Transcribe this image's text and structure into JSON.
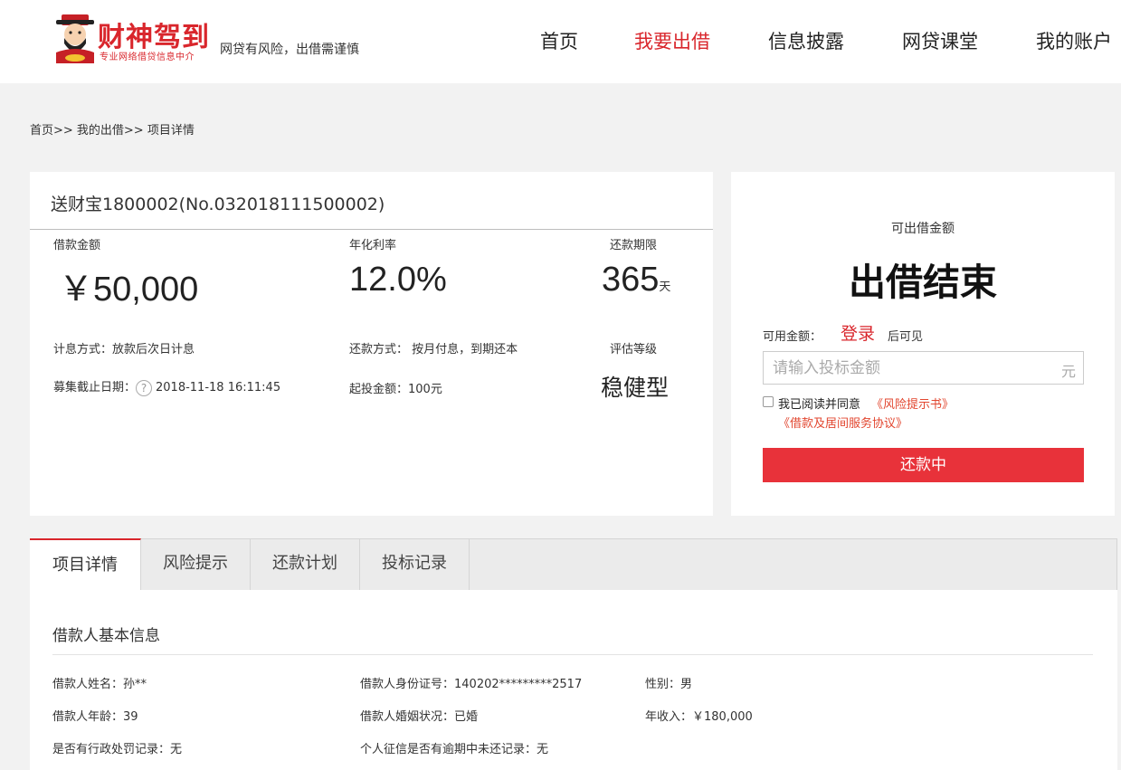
{
  "header": {
    "logo_text": "财神驾到",
    "logo_sub": "专业网络借贷信息中介",
    "slogan": "网贷有风险，出借需谨慎",
    "nav": [
      "首页",
      "我要出借",
      "信息披露",
      "网贷课堂",
      "我的账户"
    ],
    "active_nav": "我要出借"
  },
  "breadcrumb": "首页>> 我的出借>> 项目详情",
  "project": {
    "title": "送财宝1800002(No.032018111500002)",
    "amount_label": "借款金额",
    "amount_value": "￥50,000",
    "rate_label": "年化利率",
    "rate_value": "12.0%",
    "term_label": "还款期限",
    "term_value": "365",
    "term_unit": "天",
    "interest_method": "计息方式：放款后次日计息",
    "repay_method": "还款方式： 按月付息，到期还本",
    "rating_label": "评估等级",
    "deadline_label": "募集截止日期：",
    "deadline_value": "2018-11-18 16:11:45",
    "min_invest": "起投金额：100元",
    "rating_value": "稳健型"
  },
  "invest_panel": {
    "available_label": "可出借金额",
    "status": "出借结束",
    "balance_label": "可用金额：",
    "login_link": "登录",
    "after_login": "后可见",
    "input_placeholder": "请输入投标金额",
    "input_unit": "元",
    "agree_text": "我已阅读并同意",
    "agree_link1": "《风险提示书》",
    "agree_link2": "《借款及居间服务协议》",
    "button_label": "还款中"
  },
  "tabs": [
    "项目详情",
    "风险提示",
    "还款计划",
    "投标记录"
  ],
  "active_tab": "项目详情",
  "borrower": {
    "section_title": "借款人基本信息",
    "name": "借款人姓名：孙**",
    "id_number": "借款人身份证号：140202*********2517",
    "gender": "性别：男",
    "age": "借款人年龄：39",
    "marital": "借款人婚姻状况：已婚",
    "income": "年收入：￥180,000",
    "admin_penalty": "是否有行政处罚记录：无",
    "credit_overdue": "个人征信是否有逾期中未还记录：无"
  },
  "colors": {
    "accent": "#d9262c",
    "button": "#e8323a",
    "link": "#e2462f",
    "background": "#f2f2f2"
  }
}
